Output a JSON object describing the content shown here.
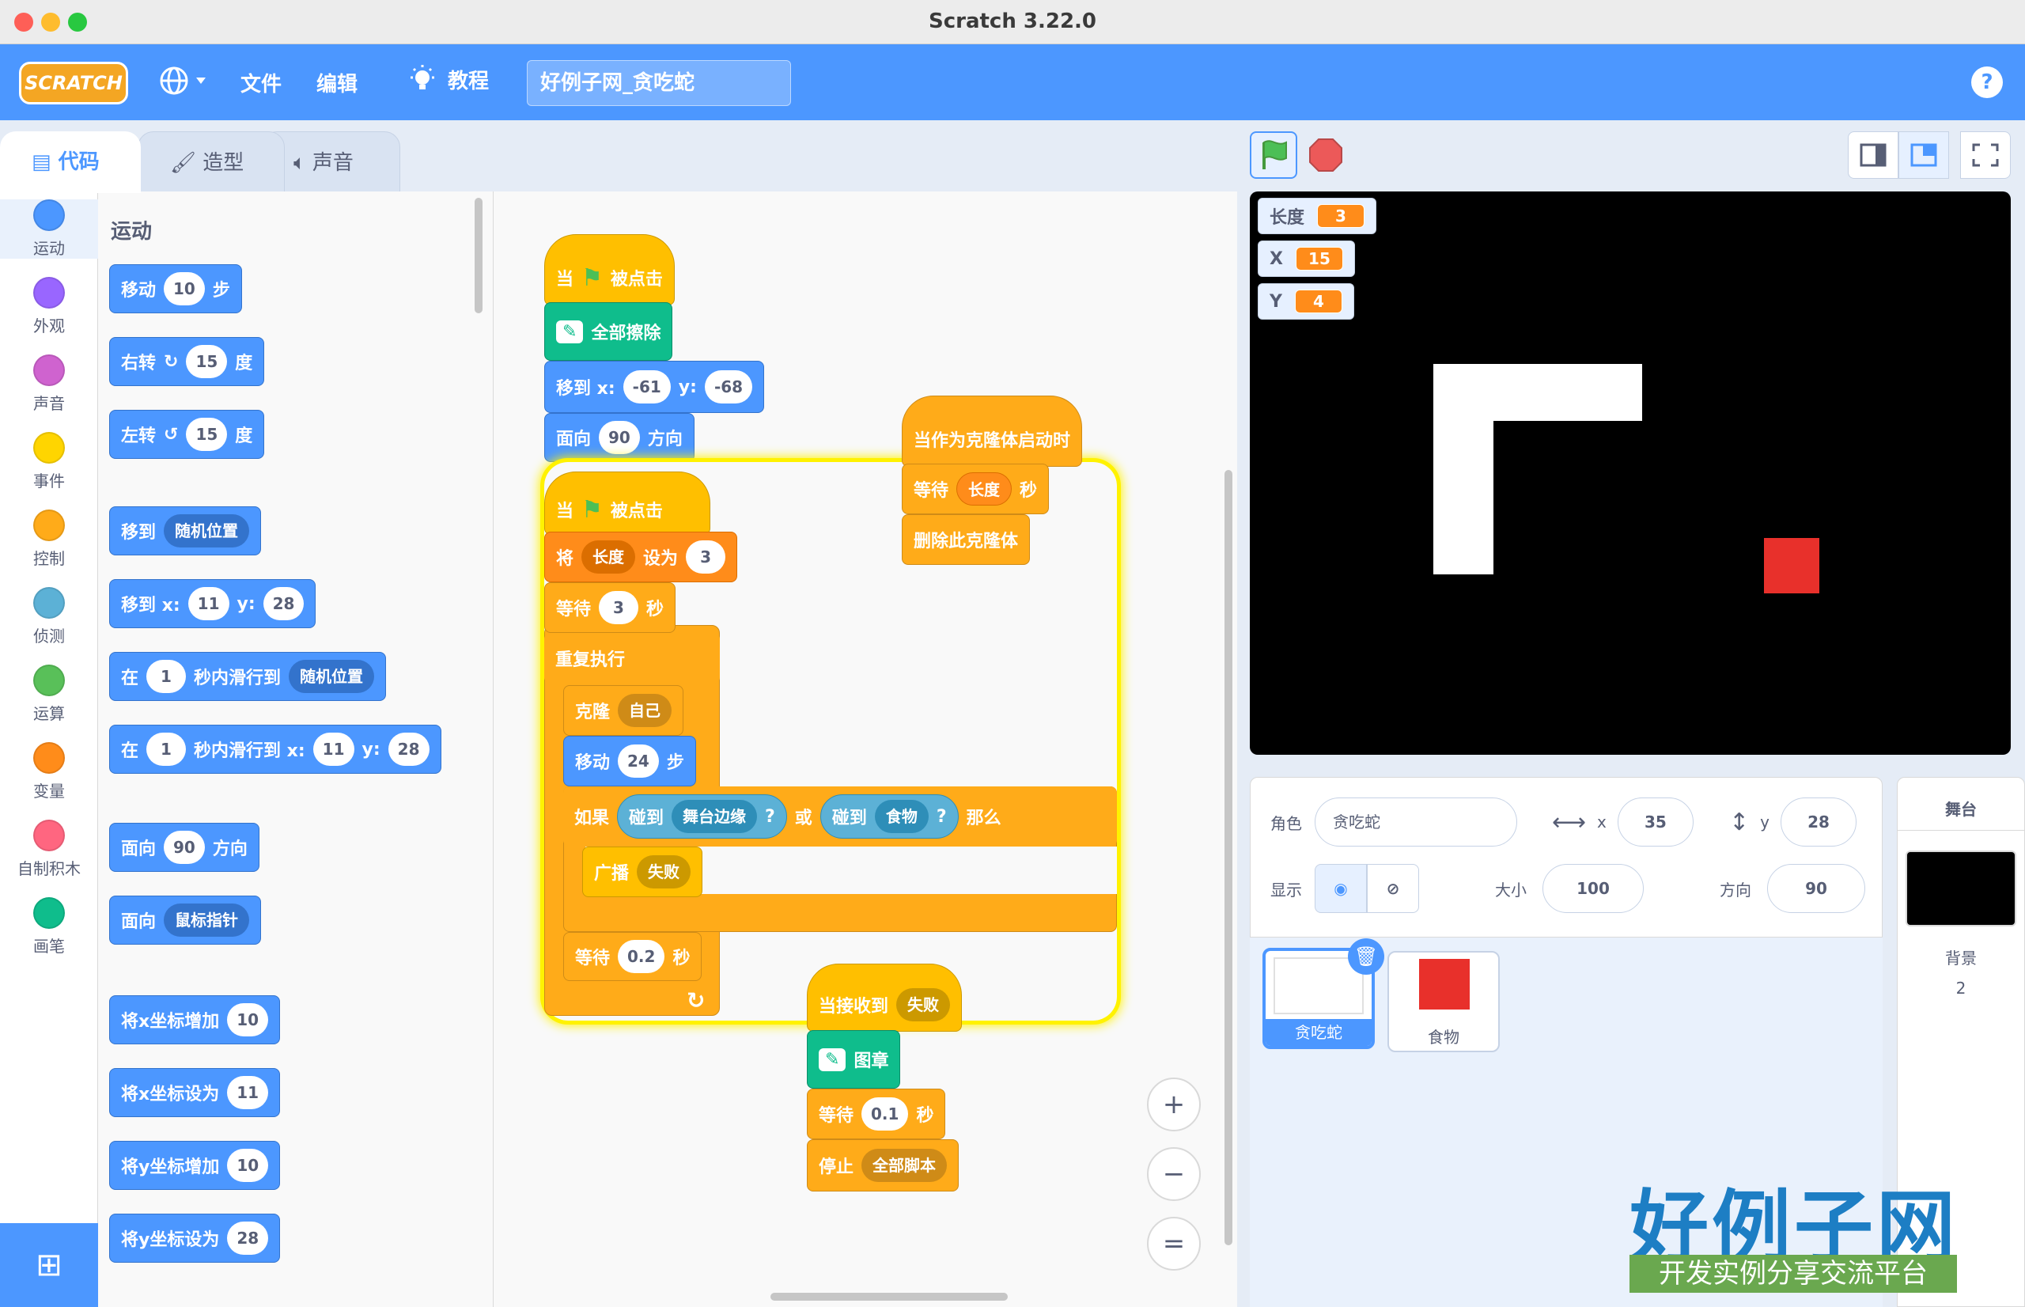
{
  "window": {
    "title": "Scratch 3.22.0"
  },
  "menubar": {
    "logo": "SCRATCH",
    "file": "文件",
    "edit": "编辑",
    "tutorials": "教程",
    "project_title": "好例子网_贪吃蛇",
    "help": "?"
  },
  "tabs": {
    "code": "代码",
    "costumes": "造型",
    "sounds": "声音"
  },
  "categories": [
    {
      "label": "运动",
      "color": "#4c97ff"
    },
    {
      "label": "外观",
      "color": "#9966ff"
    },
    {
      "label": "声音",
      "color": "#cf63cf"
    },
    {
      "label": "事件",
      "color": "#ffd500"
    },
    {
      "label": "控制",
      "color": "#ffab19"
    },
    {
      "label": "侦测",
      "color": "#5cb1d6"
    },
    {
      "label": "运算",
      "color": "#59c059"
    },
    {
      "label": "变量",
      "color": "#ff8c1a"
    },
    {
      "label": "自制积木",
      "color": "#ff6680"
    },
    {
      "label": "画笔",
      "color": "#0fbd8c"
    }
  ],
  "palette": {
    "title": "运动",
    "move": {
      "a": "移动",
      "v": "10",
      "b": "步"
    },
    "turn_right": {
      "a": "右转",
      "v": "15",
      "b": "度"
    },
    "turn_left": {
      "a": "左转",
      "v": "15",
      "b": "度"
    },
    "goto": {
      "a": "移到",
      "d": "随机位置"
    },
    "goto_xy": {
      "a": "移到 x:",
      "x": "11",
      "b": "y:",
      "y": "28"
    },
    "glide": {
      "a": "在",
      "v": "1",
      "b": "秒内滑行到",
      "d": "随机位置"
    },
    "glide_xy": {
      "a": "在",
      "v": "1",
      "b": "秒内滑行到 x:",
      "x": "11",
      "c": "y:",
      "y": "28"
    },
    "point_dir": {
      "a": "面向",
      "v": "90",
      "b": "方向"
    },
    "point_towards": {
      "a": "面向",
      "d": "鼠标指针"
    },
    "change_x": {
      "a": "将x坐标增加",
      "v": "10"
    },
    "set_x": {
      "a": "将x坐标设为",
      "v": "11"
    },
    "change_y": {
      "a": "将y坐标增加",
      "v": "10"
    },
    "set_y": {
      "a": "将y坐标设为",
      "v": "28"
    }
  },
  "scripts": {
    "s1": {
      "hat_a": "当",
      "hat_b": "被点击",
      "clear": "全部擦除",
      "goto_a": "移到 x:",
      "goto_x": "-61",
      "goto_b": "y:",
      "goto_y": "-68",
      "face_a": "面向",
      "face_v": "90",
      "face_b": "方向"
    },
    "s2": {
      "hat_a": "当",
      "hat_b": "被点击",
      "set_a": "将",
      "set_var": "长度",
      "set_b": "设为",
      "set_v": "3",
      "wait_a": "等待",
      "wait_v": "3",
      "wait_b": "秒",
      "forever": "重复执行",
      "clone_a": "克隆",
      "clone_d": "自己",
      "move_a": "移动",
      "move_v": "24",
      "move_b": "步",
      "if_a": "如果",
      "touch1_a": "碰到",
      "touch1_d": "舞台边缘",
      "q1": "?",
      "or": "或",
      "touch2_a": "碰到",
      "touch2_d": "食物",
      "q2": "?",
      "then": "那么",
      "bcast_a": "广播",
      "bcast_d": "失败",
      "wait2_a": "等待",
      "wait2_v": "0.2",
      "wait2_b": "秒",
      "loop_arrow": "↻"
    },
    "s3": {
      "hat": "当作为克隆体启动时",
      "wait_a": "等待",
      "wait_var": "长度",
      "wait_b": "秒",
      "delete": "删除此克隆体"
    },
    "s4": {
      "hat_a": "当接收到",
      "hat_d": "失败",
      "stamp": "图章",
      "wait_a": "等待",
      "wait_v": "0.1",
      "wait_b": "秒",
      "stop_a": "停止",
      "stop_d": "全部脚本"
    }
  },
  "zoom": {
    "in": "+",
    "out": "−",
    "reset": "="
  },
  "monitors": [
    {
      "name": "长度",
      "value": "3"
    },
    {
      "name": "X",
      "value": "15"
    },
    {
      "name": "Y",
      "value": "4"
    }
  ],
  "sprite_info": {
    "sprite_label": "角色",
    "sprite_name": "贪吃蛇",
    "x_label": "x",
    "x": "35",
    "y_label": "y",
    "y": "28",
    "show_label": "显示",
    "size_label": "大小",
    "size": "100",
    "direction_label": "方向",
    "direction": "90"
  },
  "sprites": [
    {
      "name": "贪吃蛇",
      "selected": true
    },
    {
      "name": "食物",
      "selected": false
    }
  ],
  "stage_pane": {
    "title": "舞台",
    "backdrop_label": "背景",
    "backdrop_count": "2"
  },
  "watermark": {
    "title": "好例子网",
    "subtitle": "开发实例分享交流平台"
  }
}
